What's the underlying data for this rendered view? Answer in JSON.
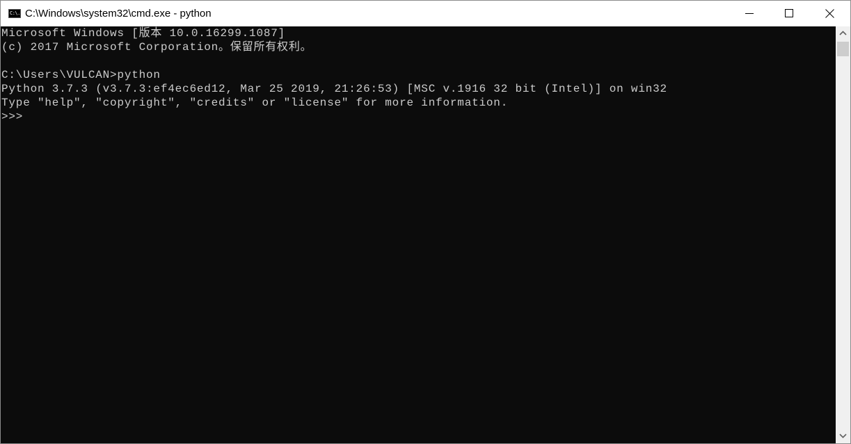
{
  "window": {
    "title": "C:\\Windows\\system32\\cmd.exe - python",
    "icon": "cmd-icon",
    "controls": {
      "minimize": "minimize-icon",
      "maximize": "maximize-icon",
      "close": "close-icon"
    }
  },
  "console": {
    "lines": [
      "Microsoft Windows [版本 10.0.16299.1087]",
      "(c) 2017 Microsoft Corporation。保留所有权利。",
      "",
      "C:\\Users\\VULCAN>python",
      "Python 3.7.3 (v3.7.3:ef4ec6ed12, Mar 25 2019, 21:26:53) [MSC v.1916 32 bit (Intel)] on win32",
      "Type ″help″, ″copyright″, ″credits″ or ″license″ for more information.",
      ">>> "
    ],
    "colors": {
      "background": "#0c0c0c",
      "foreground": "#cccccc"
    }
  },
  "scrollbar": {
    "up_icon": "chevron-up-icon",
    "down_icon": "chevron-down-icon"
  }
}
